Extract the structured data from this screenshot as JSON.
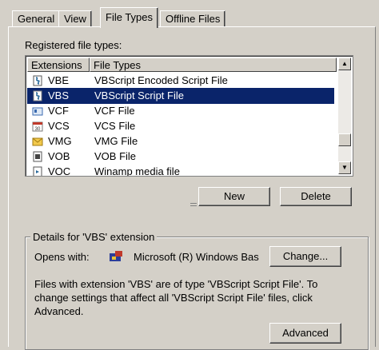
{
  "tabs": [
    {
      "label": "General"
    },
    {
      "label": "View"
    },
    {
      "label": "File Types",
      "active": true
    },
    {
      "label": "Offline Files"
    }
  ],
  "registered_label": "Registered file types:",
  "list": {
    "columns": [
      "Extensions",
      "File Types"
    ],
    "rows": [
      {
        "ext": "VBE",
        "type": "VBScript Encoded Script File",
        "icon": "script-icon"
      },
      {
        "ext": "VBS",
        "type": "VBScript Script File",
        "icon": "script-icon",
        "selected": true
      },
      {
        "ext": "VCF",
        "type": "VCF File",
        "icon": "vcard-icon"
      },
      {
        "ext": "VCS",
        "type": "VCS File",
        "icon": "calendar-icon"
      },
      {
        "ext": "VMG",
        "type": "VMG File",
        "icon": "envelope-icon"
      },
      {
        "ext": "VOB",
        "type": "VOB File",
        "icon": "film-icon"
      },
      {
        "ext": "VOC",
        "type": "Winamp media file",
        "icon": "media-file-icon"
      }
    ]
  },
  "buttons": {
    "new": "New",
    "delete": "Delete",
    "change": "Change...",
    "advanced": "Advanced"
  },
  "details": {
    "title": "Details for 'VBS' extension",
    "opens_with_label": "Opens with:",
    "opens_with_value": "Microsoft (R) Windows Bas",
    "description": "Files with extension 'VBS' are of type 'VBScript Script File'.  To change settings that affect all 'VBScript Script File' files, click Advanced."
  },
  "colors": {
    "selection": "#0a246a",
    "face": "#d4d0c8"
  }
}
